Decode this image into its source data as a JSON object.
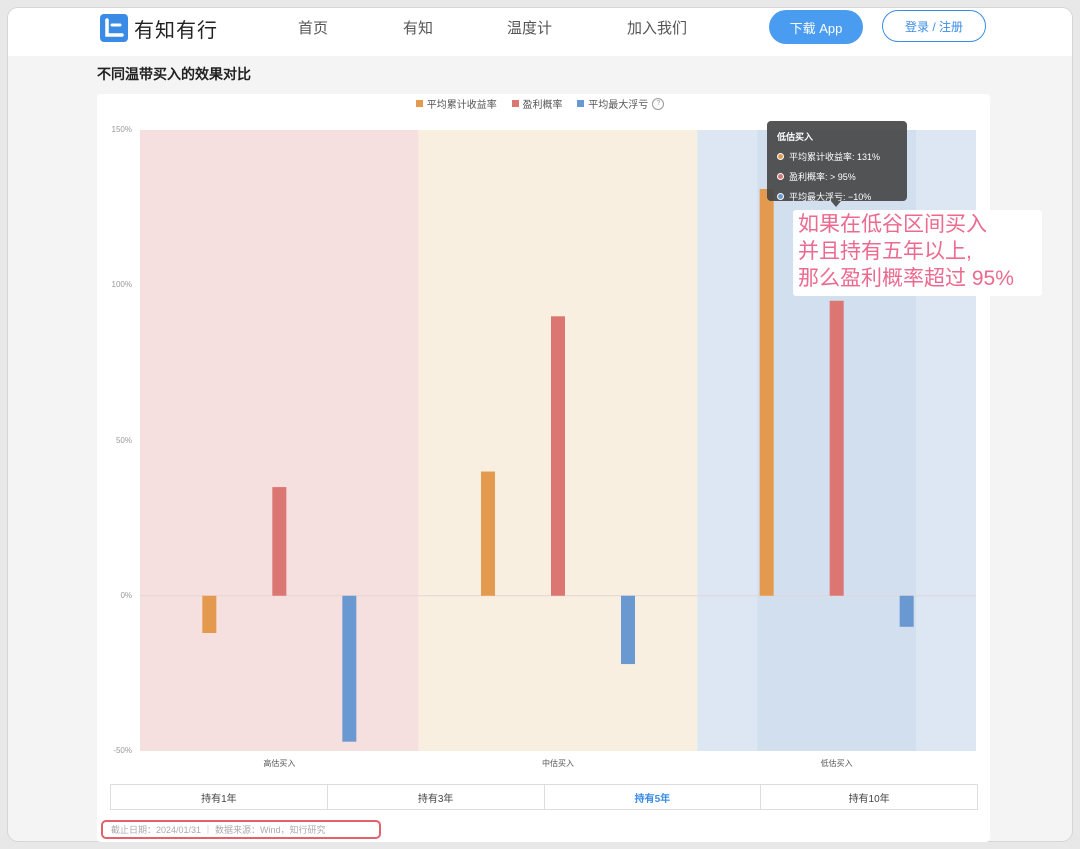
{
  "header": {
    "logo_text": "有知有行",
    "nav": [
      "首页",
      "有知",
      "温度计",
      "加入我们"
    ],
    "download_label": "下载 App",
    "login_label": "登录 / 注册"
  },
  "section_title": "不同温带买入的效果对比",
  "legend_help_icon": "question-circle-icon",
  "tabs": [
    "持有1年",
    "持有3年",
    "持有5年",
    "持有10年"
  ],
  "active_tab": "持有5年",
  "source_text": "截止日期：2024/01/31 ｜ 数据来源：Wind，知行研究",
  "tooltip": {
    "title": "低估买入",
    "rows": [
      {
        "label": "平均累计收益率: 131%",
        "color": "#e49a4e"
      },
      {
        "label": "盈利概率: > 95%",
        "color": "#dc7672"
      },
      {
        "label": "平均最大浮亏: −10%",
        "color": "#6a99d2"
      }
    ]
  },
  "annotation": [
    "如果在低谷区间买入",
    "并且持有五年以上,",
    "那么盈利概率超过 95%"
  ],
  "chart_data": {
    "type": "bar",
    "categories": [
      "高估买入",
      "中估买入",
      "低估买入"
    ],
    "series": [
      {
        "name": "平均累计收益率",
        "color": "#e49a4e",
        "values": [
          -12,
          40,
          131
        ]
      },
      {
        "name": "盈利概率",
        "color": "#dc7672",
        "values": [
          35,
          90,
          95
        ]
      },
      {
        "name": "平均最大浮亏",
        "color": "#6a99d2",
        "values": [
          -47,
          -22,
          -10
        ]
      }
    ],
    "yticks": [
      "150%",
      "100%",
      "50%",
      "0%",
      "-50%"
    ],
    "ylim": [
      -50,
      150
    ],
    "category_backgrounds": [
      "#f6e0df",
      "#f8efe1",
      "#dde7f3"
    ],
    "legend_position": "top-center"
  }
}
